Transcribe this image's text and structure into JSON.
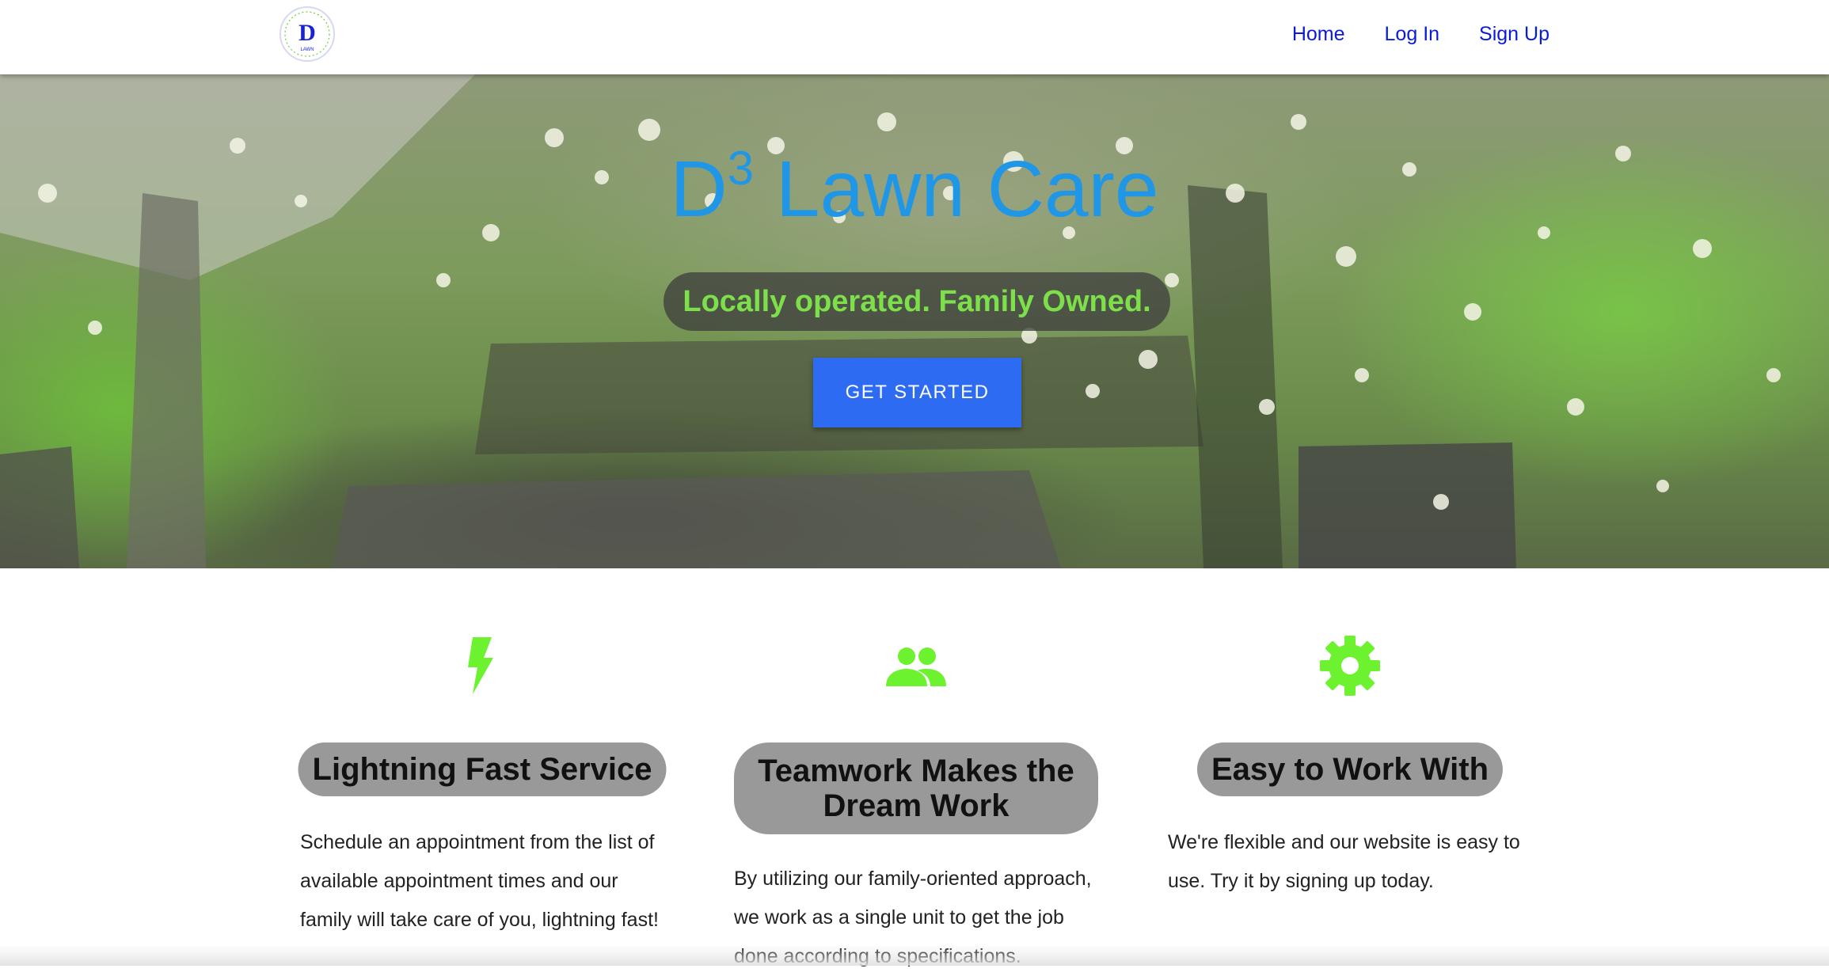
{
  "nav": {
    "logo_letter": "D",
    "logo_text_top": "LOCALLY OWNED",
    "logo_text_bottom": "FAMILY OPERATED",
    "logo_middle": "LAWN",
    "links": [
      "Home",
      "Log In",
      "Sign Up"
    ],
    "link_color": "#0a1cd8"
  },
  "hero": {
    "title_prefix": "D",
    "title_sup": "3",
    "title_rest": " Lawn Care",
    "tagline": "Locally operated. Family Owned.",
    "cta_label": "GET STARTED",
    "title_color": "#1f97e6",
    "tagline_color": "#7de04a",
    "cta_color": "#2d6bf2"
  },
  "features": [
    {
      "icon": "lightning-bolt-icon",
      "heading": "Lightning Fast Service",
      "text": "Schedule an appointment from the list of available appointment times and our family will take care of you, lightning fast!"
    },
    {
      "icon": "people-group-icon",
      "heading": "Teamwork Makes the Dream Work",
      "text": "By utilizing our family-oriented approach, we work as a single unit to get the job done according to specifications."
    },
    {
      "icon": "gear-icon",
      "heading": "Easy to Work With",
      "text": "We're flexible and our website is easy to use. Try it by signing up today."
    }
  ],
  "icon_color": "#6cf22e"
}
